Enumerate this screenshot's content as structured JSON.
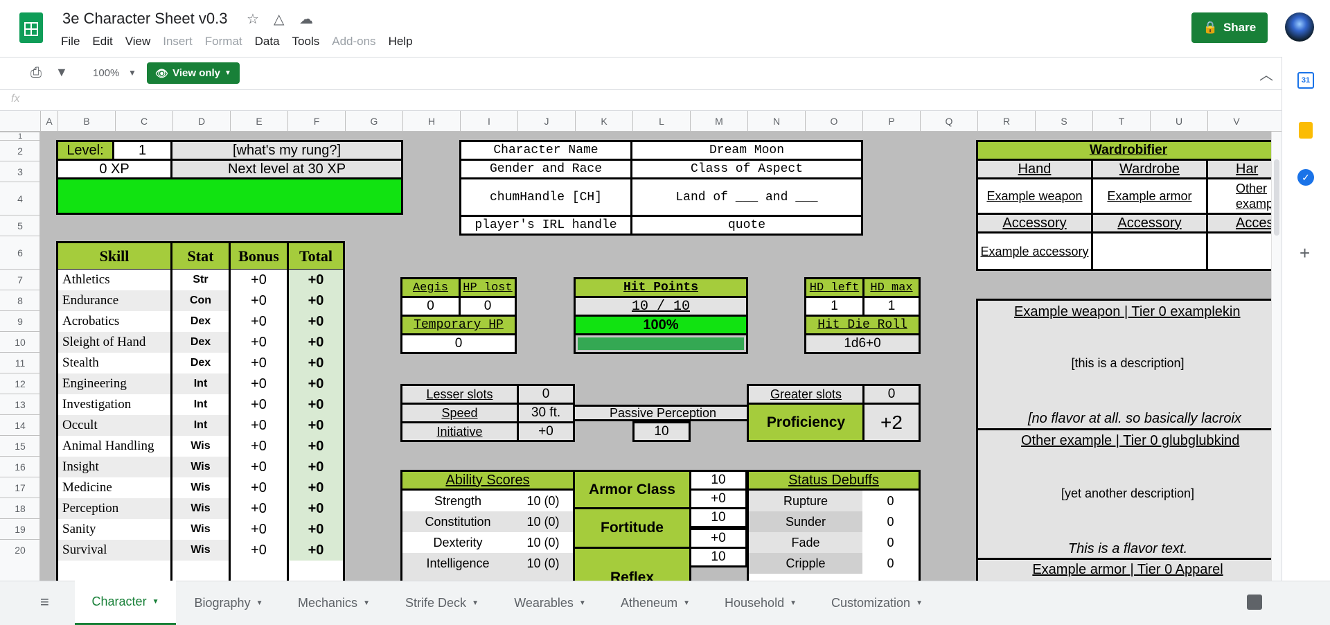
{
  "doc": {
    "title": "3e Character Sheet v0.3",
    "share": "Share",
    "menu": [
      "File",
      "Edit",
      "View",
      "Insert",
      "Format",
      "Data",
      "Tools",
      "Add-ons",
      "Help"
    ],
    "zoom": "100%",
    "view_only": "View only",
    "fx": "fx"
  },
  "columns": [
    "A",
    "B",
    "C",
    "D",
    "E",
    "F",
    "G",
    "H",
    "I",
    "J",
    "K",
    "L",
    "M",
    "N",
    "O",
    "P",
    "Q",
    "R",
    "S",
    "T",
    "U",
    "V"
  ],
  "rows": [
    "1",
    "2",
    "3",
    "4",
    "5",
    "6",
    "7",
    "8",
    "9",
    "10",
    "11",
    "12",
    "13",
    "14",
    "15",
    "16",
    "17",
    "18",
    "19",
    "20"
  ],
  "level": {
    "label": "Level:",
    "value": "1",
    "rung": "[what's my rung?]",
    "xp": "0 XP",
    "next": "Next level at 30 XP"
  },
  "info": [
    [
      "Character Name",
      "Dream Moon"
    ],
    [
      "Gender and Race",
      "Class of Aspect"
    ],
    [
      "chumHandle [CH]",
      "Land of ___ and ___"
    ],
    [
      "player's IRL handle",
      "quote"
    ]
  ],
  "wardrobe": {
    "title": "Wardrobifier",
    "h1": "Hand",
    "h2": "Wardrobe",
    "h3": "Har",
    "i1": "Example weapon",
    "i2": "Example armor",
    "i3": "Other examp",
    "a1": "Accessory",
    "a2": "Accessory",
    "a3": "Access",
    "ai1": "Example accessory"
  },
  "skills_hdr": {
    "skill": "Skill",
    "stat": "Stat",
    "bonus": "Bonus",
    "total": "Total"
  },
  "skills": [
    [
      "Athletics",
      "Str",
      "+0",
      "+0"
    ],
    [
      "Endurance",
      "Con",
      "+0",
      "+0"
    ],
    [
      "Acrobatics",
      "Dex",
      "+0",
      "+0"
    ],
    [
      "Sleight of Hand",
      "Dex",
      "+0",
      "+0"
    ],
    [
      "Stealth",
      "Dex",
      "+0",
      "+0"
    ],
    [
      "Engineering",
      "Int",
      "+0",
      "+0"
    ],
    [
      "Investigation",
      "Int",
      "+0",
      "+0"
    ],
    [
      "Occult",
      "Int",
      "+0",
      "+0"
    ],
    [
      "Animal Handling",
      "Wis",
      "+0",
      "+0"
    ],
    [
      "Insight",
      "Wis",
      "+0",
      "+0"
    ],
    [
      "Medicine",
      "Wis",
      "+0",
      "+0"
    ],
    [
      "Perception",
      "Wis",
      "+0",
      "+0"
    ],
    [
      "Sanity",
      "Wis",
      "+0",
      "+0"
    ],
    [
      "Survival",
      "Wis",
      "+0",
      "+0"
    ]
  ],
  "aegis": {
    "aegis": "Aegis",
    "hplost": "HP lost",
    "aegis_v": "0",
    "hplost_v": "0",
    "temp": "Temporary HP",
    "temp_v": "0"
  },
  "hp": {
    "label": "Hit Points",
    "value": "10 / 10",
    "pct": "100%",
    "fill": 1.0
  },
  "hd": {
    "left": "HD left",
    "max": "HD max",
    "left_v": "1",
    "max_v": "1",
    "roll": "Hit Die Roll",
    "roll_v": "1d6+0"
  },
  "slots": {
    "lesser": "Lesser slots",
    "lesser_v": "0",
    "speed": "Speed",
    "speed_v": "30 ft.",
    "init": "Initiative",
    "init_v": "+0",
    "pp": "Passive Perception",
    "pp_v": "10",
    "greater": "Greater slots",
    "greater_v": "0",
    "prof": "Proficiency",
    "prof_v": "+2"
  },
  "ability": {
    "title": "Ability Scores",
    "rows": [
      [
        "Strength",
        "10 (0)"
      ],
      [
        "Constitution",
        "10 (0)"
      ],
      [
        "Dexterity",
        "10 (0)"
      ],
      [
        "Intelligence",
        "10 (0)"
      ]
    ]
  },
  "defense": {
    "ac": "Armor Class",
    "ac_v": "10",
    "ac_b": "+0",
    "fort": "Fortitude",
    "fort_v": "10",
    "fort_b": "+0",
    "ref": "Reflex",
    "ref_v": "10"
  },
  "debuffs": {
    "title": "Status Debuffs",
    "rows": [
      [
        "Rupture",
        "0"
      ],
      [
        "Sunder",
        "0"
      ],
      [
        "Fade",
        "0"
      ],
      [
        "Cripple",
        "0"
      ]
    ]
  },
  "items": [
    {
      "title": "Example weapon | Tier 0 examplekin",
      "desc": "[this is a description]",
      "flavor": "[no flavor at all. so basically lacroix"
    },
    {
      "title": "Other example | Tier 0 glubglubkind",
      "desc": "[yet another description]",
      "flavor": "This is a flavor text."
    },
    {
      "title": "Example armor | Tier 0 Apparel"
    }
  ],
  "tabs": [
    "Character",
    "Biography",
    "Mechanics",
    "Strife Deck",
    "Wearables",
    "Atheneum",
    "Household",
    "Customization"
  ]
}
